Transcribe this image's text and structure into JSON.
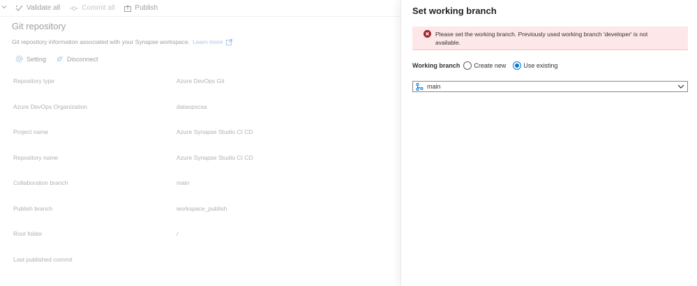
{
  "toolbar": {
    "validate_all": "Validate all",
    "commit_all": "Commit all",
    "publish": "Publish"
  },
  "git": {
    "title": "Git repository",
    "subtitle": "Git repository information associated with your Synapse workspace.",
    "learn_more": "Learn more",
    "setting": "Setting",
    "disconnect": "Disconnect"
  },
  "properties": [
    {
      "label": "Repository type",
      "value": "Azure DevOps Git"
    },
    {
      "label": "Azure DevOps Organization",
      "value": "dataopscsa"
    },
    {
      "label": "Project name",
      "value": "Azure Synapse Studio CI CD"
    },
    {
      "label": "Repository name",
      "value": "Azure Synapse Studio CI CD"
    },
    {
      "label": "Collaboration branch",
      "value": "main"
    },
    {
      "label": "Publish branch",
      "value": "workspace_publish"
    },
    {
      "label": "Root folder",
      "value": "/"
    },
    {
      "label": "Last published commit",
      "value": ""
    }
  ],
  "panel": {
    "title": "Set working branch",
    "error": "Please set the working branch. Previously used working branch 'developer' is not available.",
    "working_branch_label": "Working branch",
    "option_create": "Create new",
    "option_existing": "Use existing",
    "selected_option": "Use existing",
    "branch_value": "main"
  },
  "colors": {
    "accent": "#0078d4",
    "error_bg": "#fde7e9",
    "error_icon": "#a4262c"
  }
}
